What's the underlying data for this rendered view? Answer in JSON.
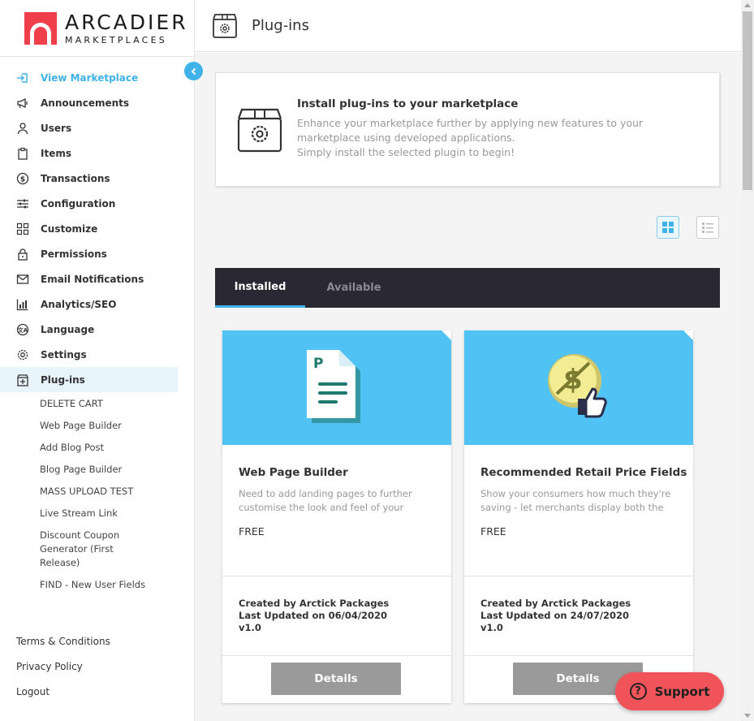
{
  "brand": {
    "name_line1": "ARCADIER",
    "name_line2": "MARKETPLACES",
    "accent": "#ee3f4a"
  },
  "header": {
    "title": "Plug-ins",
    "icon": "plugin-box-icon"
  },
  "sidebar": {
    "items": [
      {
        "label": "View Marketplace",
        "icon": "enter-icon",
        "active": true
      },
      {
        "label": "Announcements",
        "icon": "megaphone-icon"
      },
      {
        "label": "Users",
        "icon": "user-icon"
      },
      {
        "label": "Items",
        "icon": "clipboard-icon"
      },
      {
        "label": "Transactions",
        "icon": "dollar-icon"
      },
      {
        "label": "Configuration",
        "icon": "sliders-icon"
      },
      {
        "label": "Customize",
        "icon": "grid-icon"
      },
      {
        "label": "Permissions",
        "icon": "lock-icon"
      },
      {
        "label": "Email Notifications",
        "icon": "envelope-icon"
      },
      {
        "label": "Analytics/SEO",
        "icon": "bar-chart-icon"
      },
      {
        "label": "Language",
        "icon": "translate-icon"
      },
      {
        "label": "Settings",
        "icon": "gear-icon"
      },
      {
        "label": "Plug-ins",
        "icon": "plugin-icon",
        "selected": true
      }
    ],
    "subitems": [
      "DELETE CART",
      "Web Page Builder",
      "Add Blog Post",
      "Blog Page Builder",
      "MASS UPLOAD TEST",
      "Live Stream Link",
      "Discount Coupon Generator (First Release)",
      "FIND - New User Fields"
    ],
    "footer": [
      "Terms & Conditions",
      "Privacy Policy",
      "Logout"
    ]
  },
  "intro": {
    "title": "Install plug-ins to your marketplace",
    "desc1": "Enhance your marketplace further by applying new features to your marketplace using developed applications.",
    "desc2": "Simply install the selected plugin to begin!"
  },
  "tabs": {
    "installed": "Installed",
    "available": "Available"
  },
  "cards": [
    {
      "title": "Web Page Builder",
      "desc": "Need to add landing pages to further customise the look and feel of your",
      "price": "FREE",
      "created_by": "Created by Arctick Packages",
      "updated": "Last Updated on 06/04/2020",
      "version": "v1.0",
      "button": "Details",
      "icon": "document-icon"
    },
    {
      "title": "Recommended Retail Price Fields",
      "desc": "Show your consumers how much they're saving - let merchants display both the",
      "price": "FREE",
      "created_by": "Created by Arctick Packages",
      "updated": "Last Updated on 24/07/2020",
      "version": "v1.0",
      "button": "Details",
      "icon": "coin-thumbs-up-icon"
    }
  ],
  "support": {
    "label": "Support"
  },
  "colors": {
    "accent_blue": "#3fb3e8",
    "banner": "#50c2f4",
    "tabbar": "#292833",
    "support": "#f0545a"
  }
}
